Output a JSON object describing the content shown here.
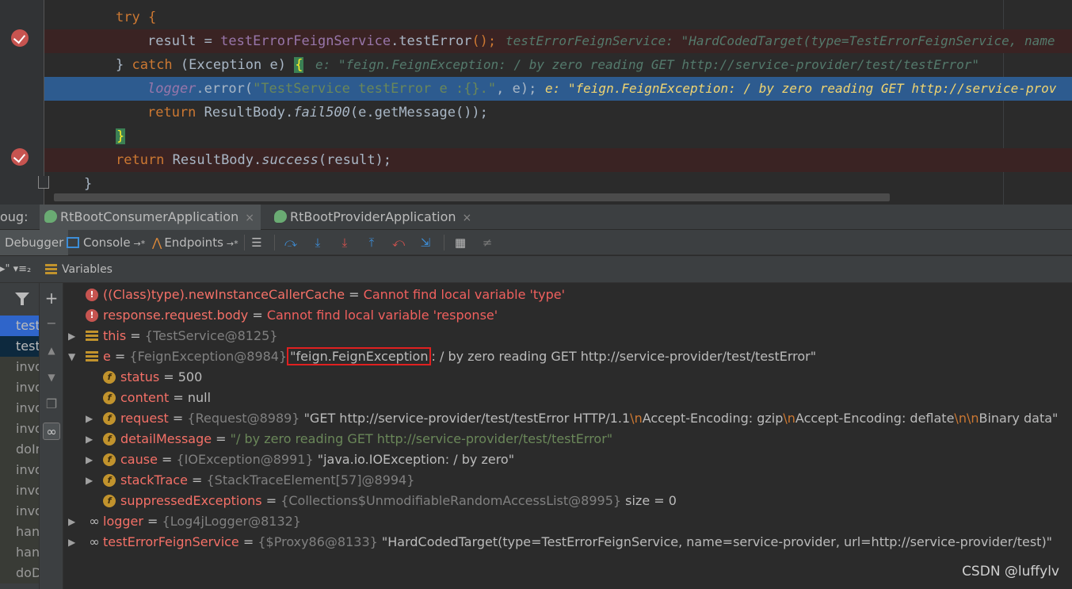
{
  "editor": {
    "lines": [
      {
        "segs": [
          {
            "t": "try {",
            "c": "kw"
          }
        ]
      },
      {
        "segs": [
          {
            "t": "result",
            "c": ""
          },
          {
            "t": " = ",
            "c": ""
          },
          {
            "t": "testErrorFeignService",
            "c": "fld"
          },
          {
            "t": ".testError",
            "c": ""
          },
          {
            "t": "();",
            "c": "kw"
          }
        ],
        "inline": "testErrorFeignService: \"HardCodedTarget(type=TestErrorFeignService, name"
      },
      {
        "segs": [
          {
            "t": "} ",
            "c": ""
          },
          {
            "t": "catch",
            "c": "kw"
          },
          {
            "t": " (Exception e) ",
            "c": ""
          },
          {
            "t": "{",
            "c": "brace"
          }
        ],
        "inline": "e: \"feign.FeignException: / by zero reading GET http://service-provider/test/testError\""
      },
      {
        "segs": [
          {
            "t": "logger",
            "c": "fld ital"
          },
          {
            "t": ".error(",
            "c": ""
          },
          {
            "t": "\"TestService testError e :{}.\"",
            "c": "str"
          },
          {
            "t": ", e);",
            "c": ""
          }
        ],
        "inline": "e: \"feign.FeignException: / by zero reading GET http://service-prov"
      },
      {
        "segs": [
          {
            "t": "return",
            "c": "kw"
          },
          {
            "t": " ResultBody.",
            "c": ""
          },
          {
            "t": "fail500",
            "c": "ital"
          },
          {
            "t": "(e.getMessage());",
            "c": ""
          }
        ]
      },
      {
        "segs": [
          {
            "t": "}",
            "c": "brace"
          }
        ]
      },
      {
        "segs": [
          {
            "t": "return",
            "c": "kw"
          },
          {
            "t": " ResultBody.",
            "c": ""
          },
          {
            "t": "success",
            "c": "ital"
          },
          {
            "t": "(result);",
            "c": ""
          }
        ]
      },
      {
        "segs": [
          {
            "t": "}",
            "c": ""
          }
        ]
      }
    ]
  },
  "debug_tabs": {
    "prefix": "oug:",
    "tabs": [
      {
        "label": "RtBootConsumerApplication",
        "close": "×"
      },
      {
        "label": "RtBootProviderApplication",
        "close": "×"
      }
    ]
  },
  "toolbar": {
    "debugger": "Debugger",
    "console": "Console",
    "console_arrow": "→*",
    "endpoints": "Endpoints",
    "endpoints_arrow": "→*"
  },
  "frames": {
    "head": "▸\" ▾≡₂",
    "items": [
      "test",
      "test",
      "invo",
      "invo",
      "invo",
      "invo",
      "doIn",
      "invo",
      "invo",
      "invo",
      "han",
      "han",
      "doD"
    ]
  },
  "variables": {
    "title": "Variables",
    "rows": [
      {
        "icon": "error",
        "name": "((Class)type).newInstanceCallerCache",
        "eq": " = ",
        "value": "Cannot find local variable 'type'"
      },
      {
        "icon": "error",
        "name": "response.request.body",
        "eq": " = ",
        "value": "Cannot find local variable 'response'"
      },
      {
        "icon": "object",
        "arrow": "▶",
        "name": "this",
        "eq": " = ",
        "ref": "{TestService@8125}"
      },
      {
        "icon": "object",
        "arrow": "▼",
        "name": "e",
        "eq": " = ",
        "ref": "{FeignException@8984}",
        "highlight": "\"feign.FeignException",
        "rest": ": / by zero reading GET http://service-provider/test/testError\""
      },
      {
        "icon": "field",
        "name": "status",
        "eq": " = ",
        "plain": "500"
      },
      {
        "icon": "field",
        "name": "content",
        "eq": " = ",
        "plain": "null"
      },
      {
        "icon": "field",
        "arrow": "▶",
        "name": "request",
        "eq": " = ",
        "ref": "{Request@8989}",
        "parts": [
          {
            "t": " \"GET http://service-provider/test/testError HTTP/1.1",
            "c": ""
          },
          {
            "t": "\\n",
            "c": "esc"
          },
          {
            "t": "Accept-Encoding: gzip",
            "c": ""
          },
          {
            "t": "\\n",
            "c": "esc"
          },
          {
            "t": "Accept-Encoding: deflate",
            "c": ""
          },
          {
            "t": "\\n\\n",
            "c": "esc"
          },
          {
            "t": "Binary data\"",
            "c": ""
          }
        ]
      },
      {
        "icon": "field",
        "arrow": "▶",
        "name": "detailMessage",
        "eq": " = ",
        "str": "\"/ by zero reading GET http://service-provider/test/testError\""
      },
      {
        "icon": "field",
        "arrow": "▶",
        "name": "cause",
        "eq": " = ",
        "ref": "{IOException@8991}",
        "plain": " \"java.io.IOException: / by zero\""
      },
      {
        "icon": "field",
        "arrow": "▶",
        "name": "stackTrace",
        "eq": " = ",
        "ref": "{StackTraceElement[57]@8994}"
      },
      {
        "icon": "field",
        "name": "suppressedExceptions",
        "eq": " = ",
        "ref": "{Collections$UnmodifiableRandomAccessList@8995}",
        "plain": "  size = 0"
      },
      {
        "icon": "infinity",
        "arrow": "▶",
        "name": "logger",
        "eq": " = ",
        "ref": "{Log4jLogger@8132}"
      },
      {
        "icon": "infinity",
        "arrow": "▶",
        "name": "testErrorFeignService",
        "eq": " = ",
        "ref": "{$Proxy86@8133}",
        "plain": " \"HardCodedTarget(type=TestErrorFeignService, name=service-provider, url=http://service-provider/test)\""
      }
    ]
  },
  "watermark": "CSDN @luffylv",
  "colors": {
    "breakpoint": "#c75450",
    "current_line": "#2d5b8f",
    "highlight_box": "#e02020"
  }
}
